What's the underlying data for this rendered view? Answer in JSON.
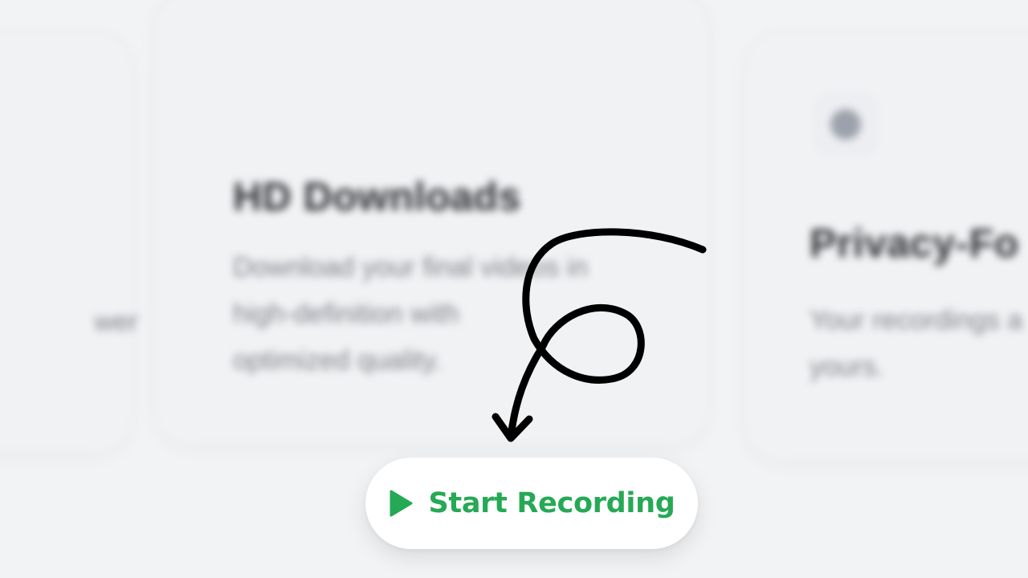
{
  "cards": {
    "left": {
      "description": "wer"
    },
    "center": {
      "title": "HD Downloads",
      "description": "Download your final videos in\nhigh-definition with\noptimized quality."
    },
    "right": {
      "icon": "privacy-icon",
      "title": "Privacy-Fo",
      "description": "Your recordings a\nyours."
    }
  },
  "cta": {
    "label": "Start Recording",
    "icon": "play-icon",
    "accent_color": "#26a955"
  },
  "annotation": {
    "icon": "hand-drawn-arrow-icon"
  }
}
